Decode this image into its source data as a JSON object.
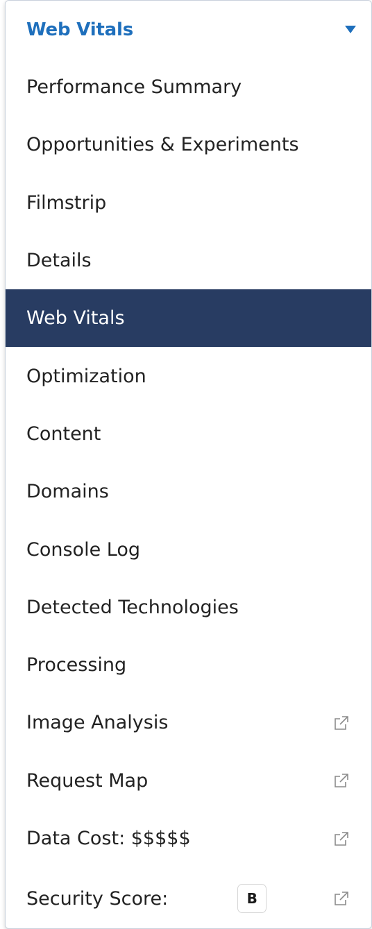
{
  "dropdown": {
    "selected_label": "Web Vitals",
    "items": [
      {
        "label": "Performance Summary",
        "external": false
      },
      {
        "label": "Opportunities & Experiments",
        "external": false
      },
      {
        "label": "Filmstrip",
        "external": false
      },
      {
        "label": "Details",
        "external": false
      },
      {
        "label": "Web Vitals",
        "external": false,
        "active": true
      },
      {
        "label": "Optimization",
        "external": false
      },
      {
        "label": "Content",
        "external": false
      },
      {
        "label": "Domains",
        "external": false
      },
      {
        "label": "Console Log",
        "external": false
      },
      {
        "label": "Detected Technologies",
        "external": false
      },
      {
        "label": "Processing",
        "external": false
      },
      {
        "label": "Image Analysis",
        "external": true
      },
      {
        "label": "Request Map",
        "external": true
      },
      {
        "label": "Data Cost: $$$$$",
        "external": true
      },
      {
        "label": "Security Score:",
        "external": true,
        "grade": "B"
      }
    ]
  },
  "colors": {
    "accent": "#1e6fbc",
    "active_bg": "#283c62",
    "text": "#222222"
  },
  "icons": {
    "caret": "caret-down-icon",
    "external": "external-link-icon"
  }
}
